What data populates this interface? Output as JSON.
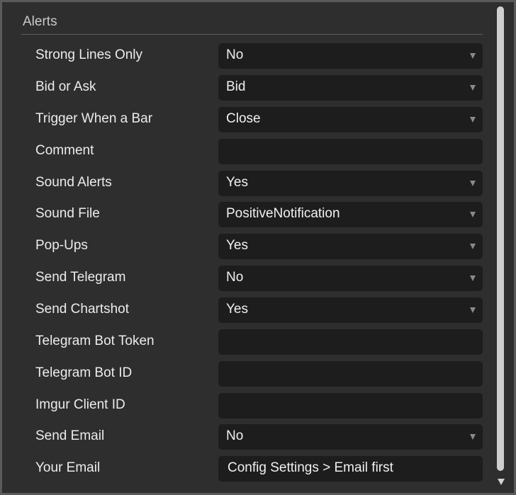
{
  "section": {
    "title": "Alerts"
  },
  "rows": [
    {
      "label": "Strong Lines Only",
      "value": "No",
      "kind": "select"
    },
    {
      "label": "Bid or Ask",
      "value": "Bid",
      "kind": "select"
    },
    {
      "label": "Trigger When a Bar",
      "value": "Close",
      "kind": "select"
    },
    {
      "label": "Comment",
      "value": "",
      "kind": "input"
    },
    {
      "label": "Sound Alerts",
      "value": "Yes",
      "kind": "select"
    },
    {
      "label": "Sound File",
      "value": "PositiveNotification",
      "kind": "select"
    },
    {
      "label": "Pop-Ups",
      "value": "Yes",
      "kind": "select"
    },
    {
      "label": "Send Telegram",
      "value": "No",
      "kind": "select"
    },
    {
      "label": "Send Chartshot",
      "value": "Yes",
      "kind": "select"
    },
    {
      "label": "Telegram Bot Token",
      "value": "",
      "kind": "input"
    },
    {
      "label": "Telegram Bot ID",
      "value": "",
      "kind": "input"
    },
    {
      "label": "Imgur Client ID",
      "value": "",
      "kind": "input"
    },
    {
      "label": "Send Email",
      "value": "No",
      "kind": "select"
    },
    {
      "label": "Your Email",
      "value": "Config Settings > Email first",
      "kind": "input"
    }
  ],
  "icons": {
    "dropdown": "chevron-down-icon",
    "scroll_down": "scroll-down-arrow-icon"
  }
}
